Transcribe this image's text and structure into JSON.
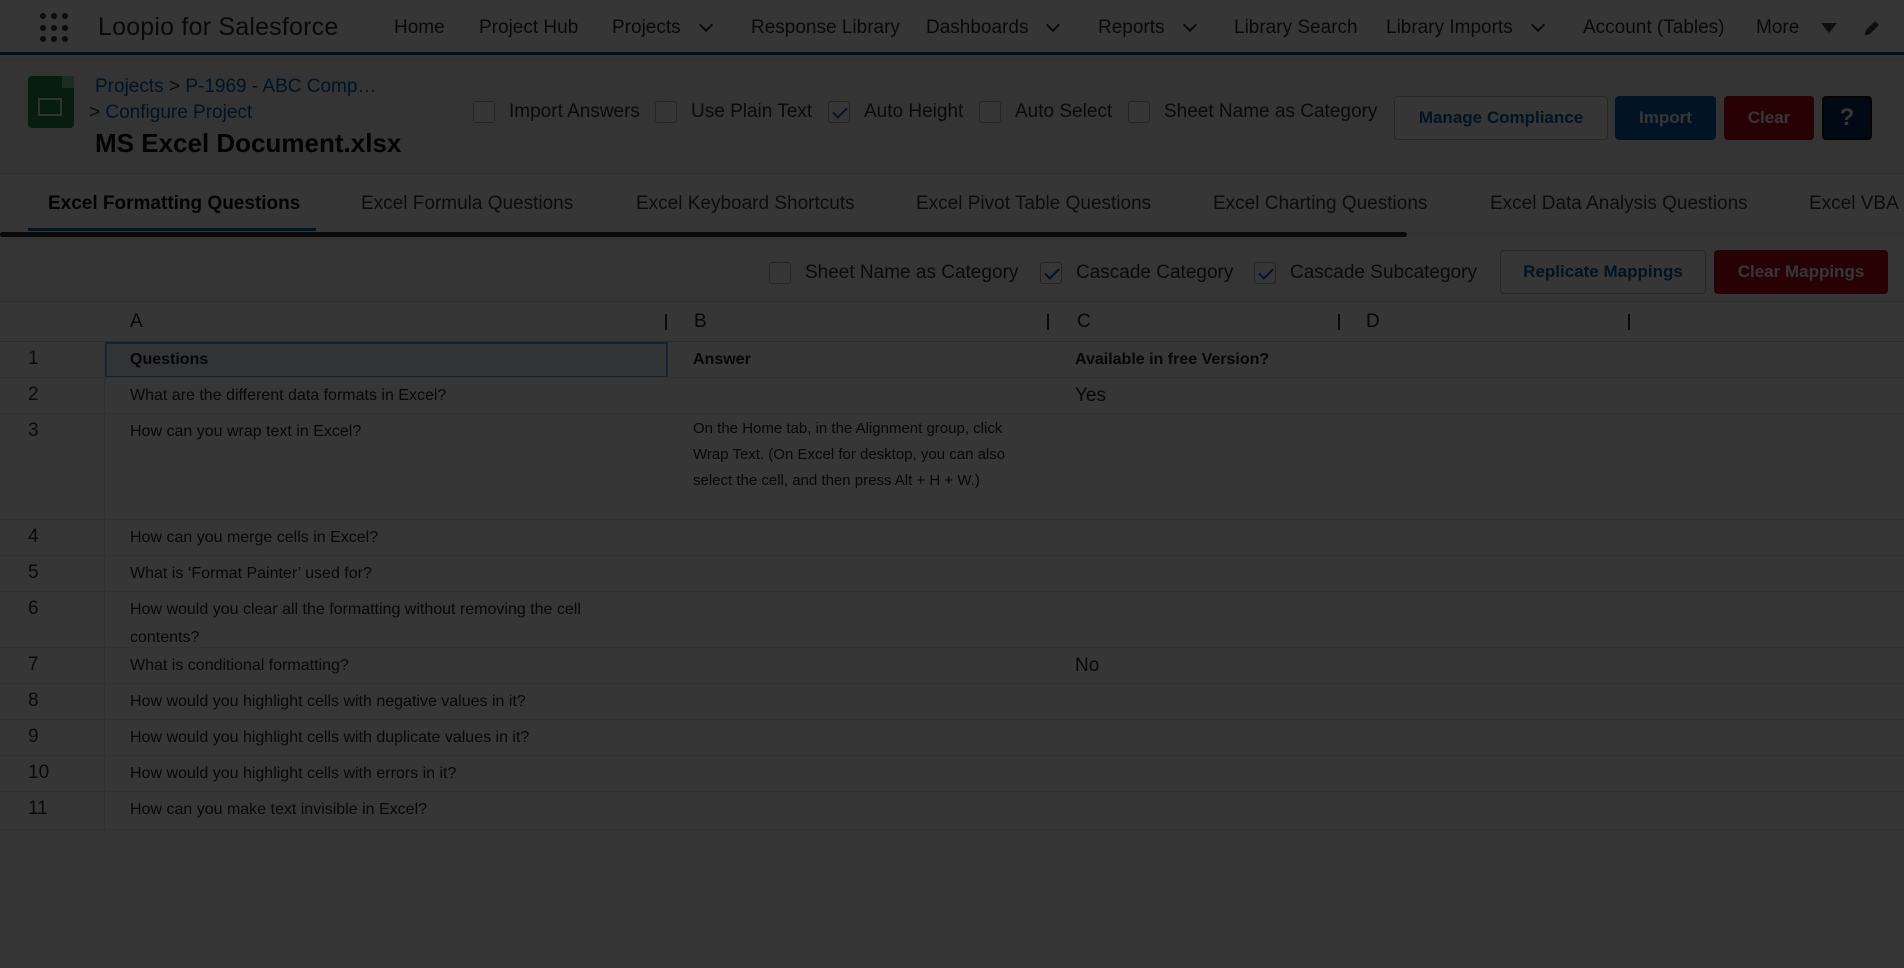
{
  "nav": {
    "app_name": "Loopio for Salesforce",
    "items": [
      {
        "label": "Home",
        "dropdown": false
      },
      {
        "label": "Project Hub",
        "dropdown": false
      },
      {
        "label": "Projects",
        "dropdown": true
      },
      {
        "label": "Response Library",
        "dropdown": false
      },
      {
        "label": "Dashboards",
        "dropdown": true
      },
      {
        "label": "Reports",
        "dropdown": true
      },
      {
        "label": "Library Search",
        "dropdown": false
      },
      {
        "label": "Library Imports",
        "dropdown": true
      },
      {
        "label": "Account (Tables)",
        "dropdown": false
      },
      {
        "label": "More",
        "dropdown": true
      }
    ],
    "accent": "#1b5297"
  },
  "header": {
    "breadcrumb_projects": "Projects",
    "breadcrumb_sep": ">",
    "breadcrumb_project": "P-1969 - ABC Comp…",
    "breadcrumb_configure": "Configure Project",
    "title": "MS Excel Document.xlsx",
    "options": [
      {
        "label": "Import Answers",
        "checked": false
      },
      {
        "label": "Use Plain Text",
        "checked": false
      },
      {
        "label": "Auto Height",
        "checked": true
      },
      {
        "label": "Auto Select",
        "checked": false
      },
      {
        "label": "Sheet Name as Category",
        "checked": false
      }
    ],
    "buttons": {
      "manage_compliance": "Manage Compliance",
      "import": "Import",
      "clear": "Clear",
      "help": "?"
    }
  },
  "tabs": [
    "Excel Formatting Questions",
    "Excel Formula Questions",
    "Excel Keyboard Shortcuts",
    "Excel Pivot Table Questions",
    "Excel Charting Questions",
    "Excel Data Analysis Questions",
    "Excel VBA"
  ],
  "mapping": {
    "options": [
      {
        "label": "Sheet Name as Category",
        "checked": false
      },
      {
        "label": "Cascade Category",
        "checked": true
      },
      {
        "label": "Cascade Subcategory",
        "checked": true
      }
    ],
    "replicate": "Replicate Mappings",
    "clear": "Clear Mappings"
  },
  "grid": {
    "columns": [
      "A",
      "B",
      "C",
      "D"
    ],
    "rows": [
      {
        "n": "1",
        "a": "Questions",
        "b": "Answer",
        "c": "Available in free Version?"
      },
      {
        "n": "2",
        "a": "What are the different data formats in Excel?",
        "b": "",
        "c": "Yes"
      },
      {
        "n": "3",
        "a": "How can you wrap text in Excel?",
        "b": "On the Home tab, in the Alignment group, click Wrap Text. (On Excel for desktop, you can also select the cell, and then press Alt + H + W.)",
        "c": ""
      },
      {
        "n": "4",
        "a": "How can you merge cells in Excel?",
        "b": "",
        "c": ""
      },
      {
        "n": "5",
        "a": "What is ‘Format Painter’ used for?",
        "b": "",
        "c": ""
      },
      {
        "n": "6",
        "a": "How would you clear all the formatting without removing the cell contents?",
        "b": "",
        "c": ""
      },
      {
        "n": "7",
        "a": "What is conditional formatting?",
        "b": "",
        "c": "No"
      },
      {
        "n": "8",
        "a": "How would you highlight cells with negative values in it?",
        "b": "",
        "c": ""
      },
      {
        "n": "9",
        "a": "How would you highlight cells with duplicate values in it?",
        "b": "",
        "c": ""
      },
      {
        "n": "10",
        "a": "How would you highlight cells with errors in it?",
        "b": "",
        "c": ""
      },
      {
        "n": "11",
        "a": "How can you make text invisible in Excel?",
        "b": "",
        "c": ""
      }
    ]
  }
}
